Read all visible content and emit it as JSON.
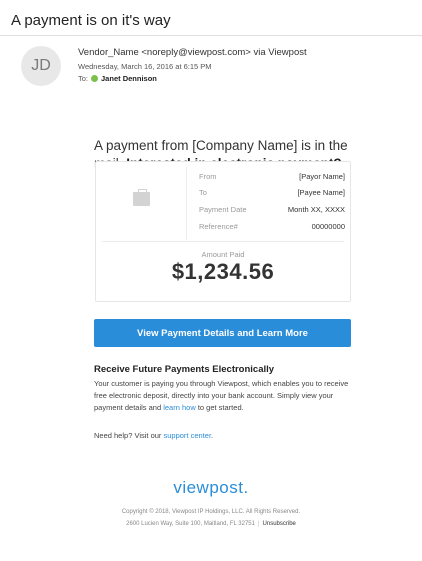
{
  "email": {
    "subject": "A payment is on it's way",
    "avatar_initials": "JD",
    "sender": "Vendor_Name <noreply@viewpost.com> via Viewpost",
    "date": "Wednesday, March 16, 2016 at 6:15 PM",
    "to_label": "To:",
    "recipient": "Janet Dennison"
  },
  "body": {
    "headline_plain": "A payment from [Company Name] is in the mail. ",
    "headline_bold": "Interested in electronic payment?",
    "details": [
      {
        "label": "From",
        "value": "[Payor Name]"
      },
      {
        "label": "To",
        "value": "[Payee Name]"
      },
      {
        "label": "Payment Date",
        "value": "Month XX, XXXX"
      },
      {
        "label": "Reference#",
        "value": "00000000"
      }
    ],
    "amount_label": "Amount Paid",
    "amount": "$1,234.56",
    "cta_label": "View Payment Details and Learn More",
    "section_title": "Receive Future Payments Electronically",
    "section_text_1": "Your customer is paying you through Viewpost, which enables you to receive free electronic deposit, directly into your bank account. Simply view your payment details and ",
    "section_link": "learn how",
    "section_text_2": " to get started.",
    "help_text": "Need help? Visit our ",
    "help_link": "support center",
    "help_end": "."
  },
  "footer": {
    "logo": "viewpost.",
    "copyright": "Copyright © 2018, Viewpost IP Holdings, LLC. All Rights Reserved.",
    "address": "2600 Lucien Way, Suite 100, Maitland, FL 32751",
    "separator": "|",
    "unsubscribe": "Unsubscribe"
  },
  "colors": {
    "accent": "#2a8dd9",
    "status_dot": "#7cc04b"
  },
  "icons": {
    "briefcase": "briefcase-icon",
    "presence": "status-dot-icon"
  }
}
